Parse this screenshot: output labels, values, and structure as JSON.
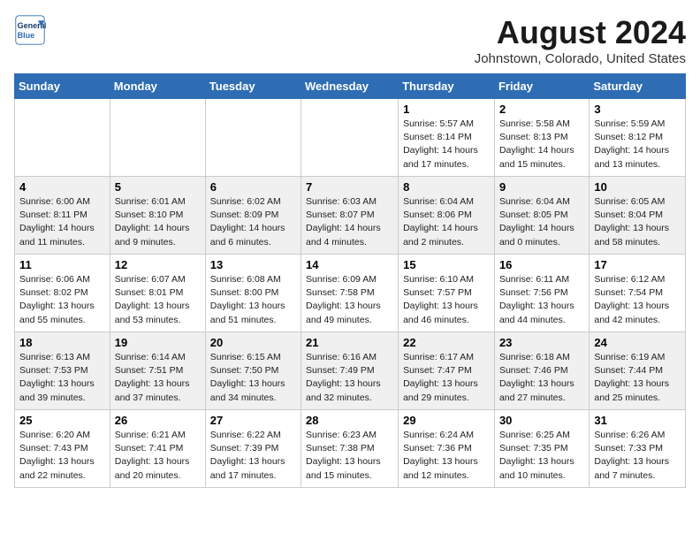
{
  "header": {
    "logo_line1": "General",
    "logo_line2": "Blue",
    "title": "August 2024",
    "subtitle": "Johnstown, Colorado, United States"
  },
  "weekdays": [
    "Sunday",
    "Monday",
    "Tuesday",
    "Wednesday",
    "Thursday",
    "Friday",
    "Saturday"
  ],
  "weeks": [
    [
      {
        "day": "",
        "sunrise": "",
        "sunset": "",
        "daylight": ""
      },
      {
        "day": "",
        "sunrise": "",
        "sunset": "",
        "daylight": ""
      },
      {
        "day": "",
        "sunrise": "",
        "sunset": "",
        "daylight": ""
      },
      {
        "day": "",
        "sunrise": "",
        "sunset": "",
        "daylight": ""
      },
      {
        "day": "1",
        "sunrise": "Sunrise: 5:57 AM",
        "sunset": "Sunset: 8:14 PM",
        "daylight": "Daylight: 14 hours and 17 minutes."
      },
      {
        "day": "2",
        "sunrise": "Sunrise: 5:58 AM",
        "sunset": "Sunset: 8:13 PM",
        "daylight": "Daylight: 14 hours and 15 minutes."
      },
      {
        "day": "3",
        "sunrise": "Sunrise: 5:59 AM",
        "sunset": "Sunset: 8:12 PM",
        "daylight": "Daylight: 14 hours and 13 minutes."
      }
    ],
    [
      {
        "day": "4",
        "sunrise": "Sunrise: 6:00 AM",
        "sunset": "Sunset: 8:11 PM",
        "daylight": "Daylight: 14 hours and 11 minutes."
      },
      {
        "day": "5",
        "sunrise": "Sunrise: 6:01 AM",
        "sunset": "Sunset: 8:10 PM",
        "daylight": "Daylight: 14 hours and 9 minutes."
      },
      {
        "day": "6",
        "sunrise": "Sunrise: 6:02 AM",
        "sunset": "Sunset: 8:09 PM",
        "daylight": "Daylight: 14 hours and 6 minutes."
      },
      {
        "day": "7",
        "sunrise": "Sunrise: 6:03 AM",
        "sunset": "Sunset: 8:07 PM",
        "daylight": "Daylight: 14 hours and 4 minutes."
      },
      {
        "day": "8",
        "sunrise": "Sunrise: 6:04 AM",
        "sunset": "Sunset: 8:06 PM",
        "daylight": "Daylight: 14 hours and 2 minutes."
      },
      {
        "day": "9",
        "sunrise": "Sunrise: 6:04 AM",
        "sunset": "Sunset: 8:05 PM",
        "daylight": "Daylight: 14 hours and 0 minutes."
      },
      {
        "day": "10",
        "sunrise": "Sunrise: 6:05 AM",
        "sunset": "Sunset: 8:04 PM",
        "daylight": "Daylight: 13 hours and 58 minutes."
      }
    ],
    [
      {
        "day": "11",
        "sunrise": "Sunrise: 6:06 AM",
        "sunset": "Sunset: 8:02 PM",
        "daylight": "Daylight: 13 hours and 55 minutes."
      },
      {
        "day": "12",
        "sunrise": "Sunrise: 6:07 AM",
        "sunset": "Sunset: 8:01 PM",
        "daylight": "Daylight: 13 hours and 53 minutes."
      },
      {
        "day": "13",
        "sunrise": "Sunrise: 6:08 AM",
        "sunset": "Sunset: 8:00 PM",
        "daylight": "Daylight: 13 hours and 51 minutes."
      },
      {
        "day": "14",
        "sunrise": "Sunrise: 6:09 AM",
        "sunset": "Sunset: 7:58 PM",
        "daylight": "Daylight: 13 hours and 49 minutes."
      },
      {
        "day": "15",
        "sunrise": "Sunrise: 6:10 AM",
        "sunset": "Sunset: 7:57 PM",
        "daylight": "Daylight: 13 hours and 46 minutes."
      },
      {
        "day": "16",
        "sunrise": "Sunrise: 6:11 AM",
        "sunset": "Sunset: 7:56 PM",
        "daylight": "Daylight: 13 hours and 44 minutes."
      },
      {
        "day": "17",
        "sunrise": "Sunrise: 6:12 AM",
        "sunset": "Sunset: 7:54 PM",
        "daylight": "Daylight: 13 hours and 42 minutes."
      }
    ],
    [
      {
        "day": "18",
        "sunrise": "Sunrise: 6:13 AM",
        "sunset": "Sunset: 7:53 PM",
        "daylight": "Daylight: 13 hours and 39 minutes."
      },
      {
        "day": "19",
        "sunrise": "Sunrise: 6:14 AM",
        "sunset": "Sunset: 7:51 PM",
        "daylight": "Daylight: 13 hours and 37 minutes."
      },
      {
        "day": "20",
        "sunrise": "Sunrise: 6:15 AM",
        "sunset": "Sunset: 7:50 PM",
        "daylight": "Daylight: 13 hours and 34 minutes."
      },
      {
        "day": "21",
        "sunrise": "Sunrise: 6:16 AM",
        "sunset": "Sunset: 7:49 PM",
        "daylight": "Daylight: 13 hours and 32 minutes."
      },
      {
        "day": "22",
        "sunrise": "Sunrise: 6:17 AM",
        "sunset": "Sunset: 7:47 PM",
        "daylight": "Daylight: 13 hours and 29 minutes."
      },
      {
        "day": "23",
        "sunrise": "Sunrise: 6:18 AM",
        "sunset": "Sunset: 7:46 PM",
        "daylight": "Daylight: 13 hours and 27 minutes."
      },
      {
        "day": "24",
        "sunrise": "Sunrise: 6:19 AM",
        "sunset": "Sunset: 7:44 PM",
        "daylight": "Daylight: 13 hours and 25 minutes."
      }
    ],
    [
      {
        "day": "25",
        "sunrise": "Sunrise: 6:20 AM",
        "sunset": "Sunset: 7:43 PM",
        "daylight": "Daylight: 13 hours and 22 minutes."
      },
      {
        "day": "26",
        "sunrise": "Sunrise: 6:21 AM",
        "sunset": "Sunset: 7:41 PM",
        "daylight": "Daylight: 13 hours and 20 minutes."
      },
      {
        "day": "27",
        "sunrise": "Sunrise: 6:22 AM",
        "sunset": "Sunset: 7:39 PM",
        "daylight": "Daylight: 13 hours and 17 minutes."
      },
      {
        "day": "28",
        "sunrise": "Sunrise: 6:23 AM",
        "sunset": "Sunset: 7:38 PM",
        "daylight": "Daylight: 13 hours and 15 minutes."
      },
      {
        "day": "29",
        "sunrise": "Sunrise: 6:24 AM",
        "sunset": "Sunset: 7:36 PM",
        "daylight": "Daylight: 13 hours and 12 minutes."
      },
      {
        "day": "30",
        "sunrise": "Sunrise: 6:25 AM",
        "sunset": "Sunset: 7:35 PM",
        "daylight": "Daylight: 13 hours and 10 minutes."
      },
      {
        "day": "31",
        "sunrise": "Sunrise: 6:26 AM",
        "sunset": "Sunset: 7:33 PM",
        "daylight": "Daylight: 13 hours and 7 minutes."
      }
    ]
  ]
}
